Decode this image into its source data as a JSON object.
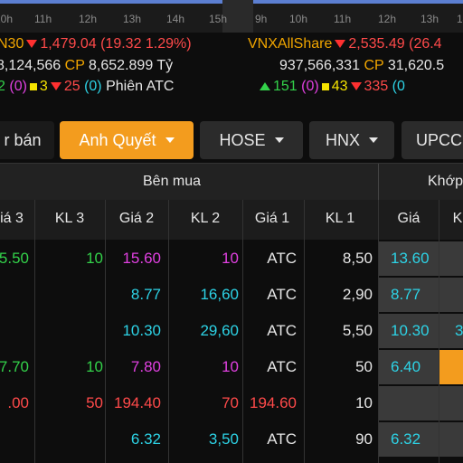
{
  "time_axis": [
    "10h",
    "11h",
    "12h",
    "13h",
    "14h",
    "15h",
    "9h",
    "10h",
    "11h",
    "12h",
    "13h",
    "14h"
  ],
  "indices": {
    "left": {
      "name": "N30",
      "value": "1,479.04",
      "change": "(19.32 1.29%)",
      "volume": "8,124,566",
      "cp_label": "CP",
      "cp_value": "8,652.899",
      "unit": "Tỷ",
      "ceil_part": "2",
      "ceil_count": "(0)",
      "ref_count": "3",
      "down_count": "25",
      "floor_count": "(0)",
      "session": "Phiên ATC"
    },
    "right": {
      "name": "VNXAllShare",
      "value": "2,535.49",
      "change": "(26.4",
      "volume": "937,566,331",
      "cp_label": "CP",
      "cp_value": "31,620.5",
      "up_count": "151",
      "ceil_count": "(0)",
      "ref_count": "43",
      "down_count": "335",
      "floor_count": "(0"
    }
  },
  "tabs": {
    "sell_label": "r bán",
    "active_label": "Anh Quyết",
    "hose": "HOSE",
    "hnx": "HNX",
    "upcom": "UPCC"
  },
  "table": {
    "group_buy": "Bên mua",
    "group_match": "Khớp",
    "headers": [
      "iá 3",
      "KL 3",
      "Giá 2",
      "KL 2",
      "Giá 1",
      "KL 1",
      "Giá",
      "K"
    ],
    "rows": [
      {
        "p3": "5.50",
        "p3c": "g",
        "k3": "10",
        "k3c": "g",
        "p2": "15.60",
        "p2c": "m",
        "k2": "10",
        "k2c": "m",
        "p1": "ATC",
        "p1c": "w",
        "k1": "8,50",
        "mp": "13.60",
        "mpc": "c",
        "ext": "",
        "extc": "c"
      },
      {
        "p3": "",
        "p3c": "w",
        "k3": "",
        "k3c": "w",
        "p2": "8.77",
        "p2c": "c",
        "k2": "16,60",
        "k2c": "c",
        "p1": "ATC",
        "p1c": "w",
        "k1": "2,90",
        "mp": "8.77",
        "mpc": "c",
        "ext": "",
        "extc": "c"
      },
      {
        "p3": "",
        "p3c": "w",
        "k3": "",
        "k3c": "w",
        "p2": "10.30",
        "p2c": "c",
        "k2": "29,60",
        "k2c": "c",
        "p1": "ATC",
        "p1c": "w",
        "k1": "5,50",
        "mp": "10.30",
        "mpc": "c",
        "ext": "3",
        "extc": "c"
      },
      {
        "p3": "7.70",
        "p3c": "g",
        "k3": "10",
        "k3c": "g",
        "p2": "7.80",
        "p2c": "m",
        "k2": "10",
        "k2c": "m",
        "p1": "ATC",
        "p1c": "w",
        "k1": "50",
        "mp": "6.40",
        "mpc": "c",
        "ext": "",
        "extc": "orange"
      },
      {
        "p3": ".00",
        "p3c": "r",
        "k3": "50",
        "k3c": "r",
        "p2": "194.40",
        "p2c": "r",
        "k2": "70",
        "k2c": "r",
        "p1": "194.60",
        "p1c": "r",
        "k1": "10",
        "mp": "",
        "mpc": "c",
        "ext": "",
        "extc": "c"
      },
      {
        "p3": "",
        "p3c": "w",
        "k3": "",
        "k3c": "w",
        "p2": "6.32",
        "p2c": "c",
        "k2": "3,50",
        "k2c": "c",
        "p1": "ATC",
        "p1c": "w",
        "k1": "90",
        "mp": "6.32",
        "mpc": "c",
        "ext": "",
        "extc": "c"
      }
    ]
  },
  "colors": {
    "accent_orange": "#f39c1e",
    "down_red": "#ff4a4a",
    "up_green": "#33d24a",
    "cyan": "#2dd3e6",
    "magenta": "#e040e0",
    "yellow": "#f5e300"
  }
}
